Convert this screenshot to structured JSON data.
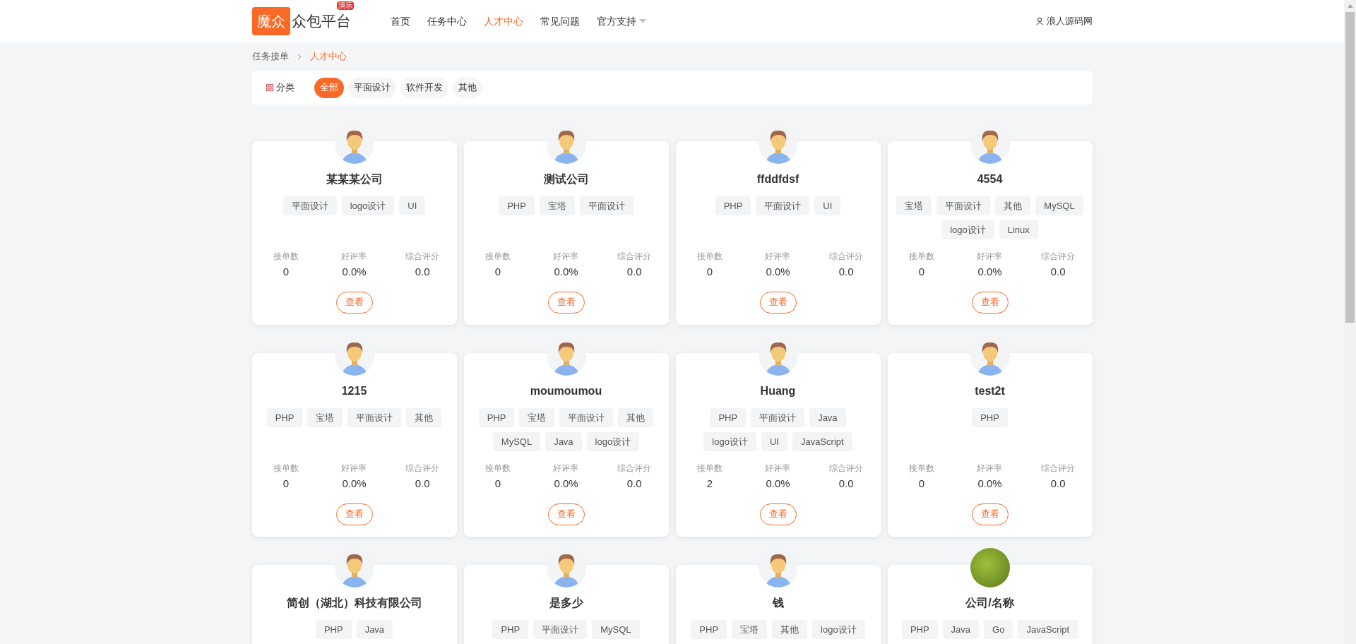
{
  "header": {
    "logo": {
      "mark": "魔众",
      "name": "众包平台",
      "badge": "演示"
    },
    "nav": [
      {
        "label": "首页",
        "selected": false,
        "dropdown": false
      },
      {
        "label": "任务中心",
        "selected": false,
        "dropdown": false
      },
      {
        "label": "人才中心",
        "selected": true,
        "dropdown": false
      },
      {
        "label": "常见问题",
        "selected": false,
        "dropdown": false
      },
      {
        "label": "官方支持",
        "selected": false,
        "dropdown": true
      }
    ],
    "user": "浪人源码网"
  },
  "breadcrumb": [
    {
      "label": "任务接单",
      "current": false
    },
    {
      "label": "人才中心",
      "current": true
    }
  ],
  "filter": {
    "label": "分类",
    "options": [
      {
        "label": "全部",
        "selected": true
      },
      {
        "label": "平面设计",
        "selected": false
      },
      {
        "label": "软件开发",
        "selected": false
      },
      {
        "label": "其他",
        "selected": false
      }
    ]
  },
  "cards": [
    {
      "name": "某某某公司",
      "photo_avatar": false,
      "tags": [
        "平面设计",
        "logo设计",
        "UI"
      ],
      "stats": [
        {
          "label": "接单数",
          "value": "0"
        },
        {
          "label": "好评率",
          "value": "0.0%"
        },
        {
          "label": "综合评分",
          "value": "0.0"
        }
      ],
      "button": "查看"
    },
    {
      "name": "测试公司",
      "photo_avatar": false,
      "tags": [
        "PHP",
        "宝塔",
        "平面设计"
      ],
      "stats": [
        {
          "label": "接单数",
          "value": "0"
        },
        {
          "label": "好评率",
          "value": "0.0%"
        },
        {
          "label": "综合评分",
          "value": "0.0"
        }
      ],
      "button": "查看"
    },
    {
      "name": "ffddfdsf",
      "photo_avatar": false,
      "tags": [
        "PHP",
        "平面设计",
        "UI"
      ],
      "stats": [
        {
          "label": "接单数",
          "value": "0"
        },
        {
          "label": "好评率",
          "value": "0.0%"
        },
        {
          "label": "综合评分",
          "value": "0.0"
        }
      ],
      "button": "查看"
    },
    {
      "name": "4554",
      "photo_avatar": false,
      "tags": [
        "宝塔",
        "平面设计",
        "其他",
        "MySQL",
        "logo设计",
        "Linux"
      ],
      "stats": [
        {
          "label": "接单数",
          "value": "0"
        },
        {
          "label": "好评率",
          "value": "0.0%"
        },
        {
          "label": "综合评分",
          "value": "0.0"
        }
      ],
      "button": "查看"
    },
    {
      "name": "1215",
      "photo_avatar": false,
      "tags": [
        "PHP",
        "宝塔",
        "平面设计",
        "其他"
      ],
      "stats": [
        {
          "label": "接单数",
          "value": "0"
        },
        {
          "label": "好评率",
          "value": "0.0%"
        },
        {
          "label": "综合评分",
          "value": "0.0"
        }
      ],
      "button": "查看"
    },
    {
      "name": "moumoumou",
      "photo_avatar": false,
      "tags": [
        "PHP",
        "宝塔",
        "平面设计",
        "其他",
        "MySQL",
        "Java",
        "logo设计"
      ],
      "stats": [
        {
          "label": "接单数",
          "value": "0"
        },
        {
          "label": "好评率",
          "value": "0.0%"
        },
        {
          "label": "综合评分",
          "value": "0.0"
        }
      ],
      "button": "查看"
    },
    {
      "name": "Huang",
      "photo_avatar": false,
      "tags": [
        "PHP",
        "平面设计",
        "Java",
        "logo设计",
        "UI",
        "JavaScript"
      ],
      "stats": [
        {
          "label": "接单数",
          "value": "2"
        },
        {
          "label": "好评率",
          "value": "0.0%"
        },
        {
          "label": "综合评分",
          "value": "0.0"
        }
      ],
      "button": "查看"
    },
    {
      "name": "test2t",
      "photo_avatar": false,
      "tags": [
        "PHP"
      ],
      "stats": [
        {
          "label": "接单数",
          "value": "0"
        },
        {
          "label": "好评率",
          "value": "0.0%"
        },
        {
          "label": "综合评分",
          "value": "0.0"
        }
      ],
      "button": "查看"
    },
    {
      "name": "简创（湖北）科技有限公司",
      "photo_avatar": false,
      "tags": [
        "PHP",
        "Java"
      ]
    },
    {
      "name": "是多少",
      "photo_avatar": false,
      "tags": [
        "PHP",
        "平面设计",
        "MySQL"
      ]
    },
    {
      "name": "钱",
      "photo_avatar": false,
      "tags": [
        "PHP",
        "宝塔",
        "其他",
        "logo设计"
      ]
    },
    {
      "name": "公司/名称",
      "photo_avatar": true,
      "tags": [
        "PHP",
        "Java",
        "Go",
        "JavaScript"
      ]
    }
  ]
}
